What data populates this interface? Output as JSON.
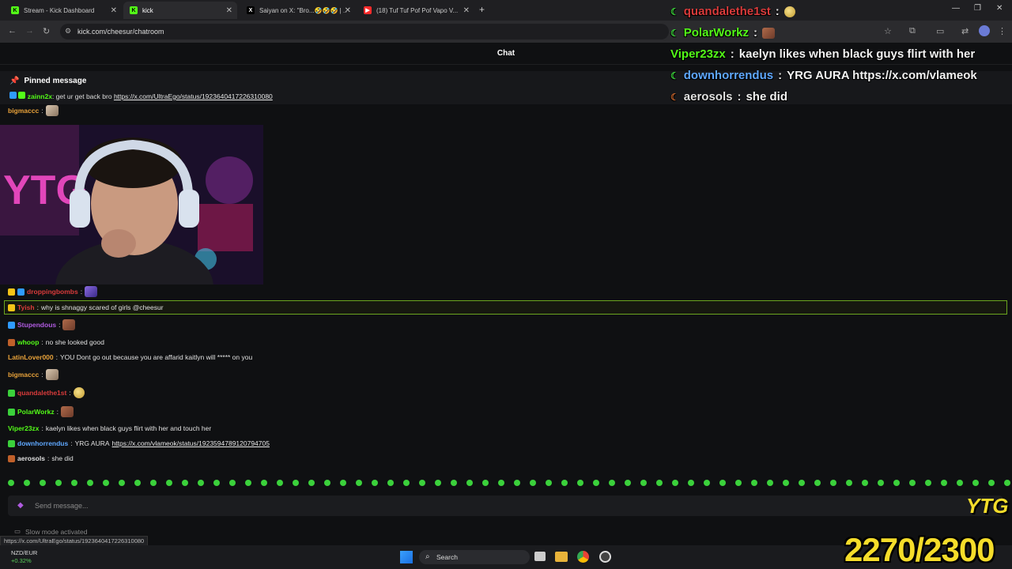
{
  "browser": {
    "tabs": [
      {
        "label": "Stream - Kick Dashboard",
        "favicon_color": "#53fc18",
        "favicon": "K"
      },
      {
        "label": "kick",
        "favicon_color": "#53fc18",
        "favicon": "K"
      },
      {
        "label": "Saiyan on X: \"Bro...🤣🤣🤣 | ...",
        "favicon_color": "#ffffff",
        "favicon": "X"
      },
      {
        "label": "(18) Tuf Tuf Pof Pof Vapo V...",
        "favicon_color": "#ff2b2b",
        "favicon": "▶"
      }
    ],
    "new_tab": "+",
    "url": "kick.com/cheesur/chatroom"
  },
  "chat": {
    "title": "Chat",
    "pinned": {
      "heading": "Pinned message",
      "user": "zainn2x",
      "user_color": "#53fc18",
      "text": "get ur get back bro",
      "link": "https://x.com/UltraEgo/status/1923640417226310080"
    },
    "messages": [
      {
        "user": "bigmaccc",
        "text": "",
        "user_color": "#e8a23a",
        "emote": "dog"
      },
      {
        "user": "droppingbombs",
        "text": "",
        "user_color": "#d93b3b",
        "emote": "purple"
      },
      {
        "user": "Tyish",
        "text": "why is shnaggy scared of girls @cheesur",
        "user_color": "#d93b3b"
      },
      {
        "user": "Stupendous",
        "text": "",
        "user_color": "#b05be0",
        "emote": "face"
      },
      {
        "user": "whoop",
        "text": "no she looked good",
        "user_color": "#53fc18"
      },
      {
        "user": "LatinLover000",
        "text": "YOU Dont go out because you are affarid kaitlyn will ***** on you",
        "user_color": "#e8a23a"
      },
      {
        "user": "bigmaccc",
        "text": "",
        "user_color": "#e8a23a",
        "emote": "dog"
      },
      {
        "user": "quandalethe1st",
        "text": "",
        "user_color": "#d93b3b",
        "emote": "coin"
      },
      {
        "user": "PolarWorkz",
        "text": "",
        "user_color": "#53fc18",
        "emote": "face"
      },
      {
        "user": "Viper23zx",
        "text": "kaelyn likes when black guys flirt with her and touch her",
        "user_color": "#53fc18"
      },
      {
        "user": "downhorrendus",
        "text": "YRG AURA",
        "link": "https://x.com/vlameok/status/1923594789120794705",
        "user_color": "#5fa8ff"
      },
      {
        "user": "aerosols",
        "text": "she did",
        "user_color": "#e0e0e0"
      }
    ],
    "input_placeholder": "Send message...",
    "slow_mode": "Slow mode activated",
    "status_url": "https://x.com/UltraEgo/status/1923640417226310080"
  },
  "overlay": {
    "messages": [
      {
        "user": "quandalethe1st",
        "text": "",
        "user_color": "#d93b3b"
      },
      {
        "user": "PolarWorkz",
        "text": "",
        "user_color": "#53fc18"
      },
      {
        "user": "Viper23zx",
        "text": "kaelyn likes when black guys flirt with her",
        "user_color": "#53fc18"
      },
      {
        "user": "downhorrendus",
        "text": "YRG AURA https://x.com/vlameok",
        "user_color": "#5fa8ff"
      },
      {
        "user": "aerosols",
        "text": "she did",
        "user_color": "#e0e0e0"
      }
    ],
    "counter": "2270/2300",
    "counter_color": "#f5dd2a",
    "logo_text": "YTG"
  },
  "taskbar": {
    "stock_name": "NZD/EUR",
    "stock_change": "+0.32%",
    "search": "Search"
  }
}
